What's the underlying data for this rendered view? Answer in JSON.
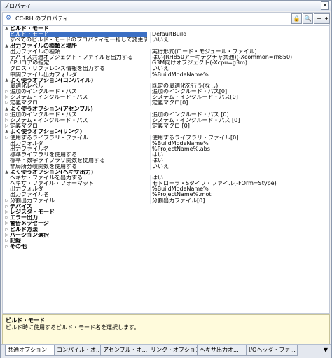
{
  "window": {
    "title": "プロパティ",
    "close_glyph": "✕"
  },
  "toolbar": {
    "target_name": "CC-RH のプロパティ",
    "btn_lock": "🔒",
    "btn_search": "🔍",
    "btn_collapse": "−",
    "btn_expand": "+"
  },
  "rows": [
    {
      "t": "cat",
      "e": "▲",
      "k": "ビルド・モード",
      "v": ""
    },
    {
      "t": "sel",
      "e": "",
      "k": "ビルド・モード",
      "v": "DefaultBuild"
    },
    {
      "t": "p",
      "e": "",
      "k": "すべてのビルド・モードのプロパティを一括して変更する",
      "v": "いいえ"
    },
    {
      "t": "cat",
      "e": "▲",
      "k": "出力ファイルの種類と場所",
      "v": ""
    },
    {
      "t": "p",
      "e": "",
      "k": "出力ファイルの種類",
      "v": "実行形式(ロード・モジュール・ファイル)"
    },
    {
      "t": "p",
      "e": "",
      "k": "デバイス共通オブジェクト・ファイルを出力する",
      "v": "はい(RH850アーキテクチャ共通)(-Xcommon=rh850)"
    },
    {
      "t": "p",
      "e": "",
      "k": "CPUコアの指定",
      "v": "G3M向けオブジェクト(-Xcpu=g3m)"
    },
    {
      "t": "p",
      "e": "",
      "k": "クロス・リファレンス情報を出力する",
      "v": "いいえ"
    },
    {
      "t": "p",
      "e": "",
      "k": "中間ファイル出力フォルダ",
      "v": "%BuildModeName%"
    },
    {
      "t": "cat",
      "e": "▲",
      "k": "よく使うオプション(コンパイル)",
      "v": ""
    },
    {
      "t": "p",
      "e": "",
      "k": "最適化レベル",
      "v": "既定の最適化を行う(なし)"
    },
    {
      "t": "p",
      "e": "▷",
      "k": "追加のインクルード・パス",
      "v": "追加のインクルード・パス[0]"
    },
    {
      "t": "p",
      "e": "▷",
      "k": "システム・インクルード・パス",
      "v": "システム・インクルード・パス[0]"
    },
    {
      "t": "p",
      "e": "▷",
      "k": "定義マクロ",
      "v": "定義マクロ[0]"
    },
    {
      "t": "cat",
      "e": "▲",
      "k": "よく使うオプション(アセンブル)",
      "v": ""
    },
    {
      "t": "p",
      "e": "▷",
      "k": "追加のインクルード・パス",
      "v": "追加のインクルード・パス [0]"
    },
    {
      "t": "p",
      "e": "▷",
      "k": "システム・インクルード・パス",
      "v": "システム・インクルード・パス [0]"
    },
    {
      "t": "p",
      "e": "▷",
      "k": "定義マクロ",
      "v": "定義マクロ [0]"
    },
    {
      "t": "cat",
      "e": "▲",
      "k": "よく使うオプション(リンク)",
      "v": ""
    },
    {
      "t": "p",
      "e": "▷",
      "k": "使用するライブラリ・ファイル",
      "v": "使用するライブラリ・ファイル[0]"
    },
    {
      "t": "p",
      "e": "",
      "k": "出力フォルダ",
      "v": "%BuildModeName%"
    },
    {
      "t": "p",
      "e": "",
      "k": "出力ファイル名",
      "v": "%ProjectName%.abs"
    },
    {
      "t": "p",
      "e": "",
      "k": "標準ライブラリを使用する",
      "v": "はい"
    },
    {
      "t": "p",
      "e": "",
      "k": "標準・数学ライブラリ関数を使用する",
      "v": "はい"
    },
    {
      "t": "p",
      "e": "",
      "k": "非局所分岐関数を使用する",
      "v": "いいえ"
    },
    {
      "t": "cat",
      "e": "▲",
      "k": "よく使うオプション(ヘキサ出力)",
      "v": ""
    },
    {
      "t": "p",
      "e": "",
      "k": "ヘキサ・ファイルを出力する",
      "v": "はい"
    },
    {
      "t": "p",
      "e": "",
      "k": "ヘキサ・ファイル・フォーマット",
      "v": "モトローラ・Sタイプ・ファイル(-FOrm=Stype)"
    },
    {
      "t": "p",
      "e": "",
      "k": "出力フォルダ",
      "v": "%BuildModeName%"
    },
    {
      "t": "p",
      "e": "",
      "k": "出力ファイル名",
      "v": "%ProjectName%.mot"
    },
    {
      "t": "p",
      "e": "▷",
      "k": "分割出力ファイル",
      "v": "分割出力ファイル[0]"
    },
    {
      "t": "cat",
      "e": "▷",
      "k": "デバイス",
      "v": ""
    },
    {
      "t": "cat",
      "e": "▷",
      "k": "レジスタ・モード",
      "v": ""
    },
    {
      "t": "cat",
      "e": "▷",
      "k": "エラー出力",
      "v": ""
    },
    {
      "t": "cat",
      "e": "▷",
      "k": "警告メッセージ",
      "v": ""
    },
    {
      "t": "cat",
      "e": "▷",
      "k": "ビルド方法",
      "v": ""
    },
    {
      "t": "cat",
      "e": "▷",
      "k": "バージョン選択",
      "v": ""
    },
    {
      "t": "cat",
      "e": "▷",
      "k": "記録",
      "v": ""
    },
    {
      "t": "cat",
      "e": "▷",
      "k": "その他",
      "v": ""
    }
  ],
  "description": {
    "title": "ビルド・モード",
    "text": "ビルド時に使用するビルド・モード名を選択します。"
  },
  "tabs": [
    {
      "label": "共通オプション",
      "active": true
    },
    {
      "label": "コンパイル・オ...",
      "active": false
    },
    {
      "label": "アセンブル・オ...",
      "active": false
    },
    {
      "label": "リンク・オプション",
      "active": false
    },
    {
      "label": "ヘキサ出力オ...",
      "active": false
    },
    {
      "label": "I/Oヘッダ・ファ...",
      "active": false
    }
  ],
  "tabs_more": "▼"
}
